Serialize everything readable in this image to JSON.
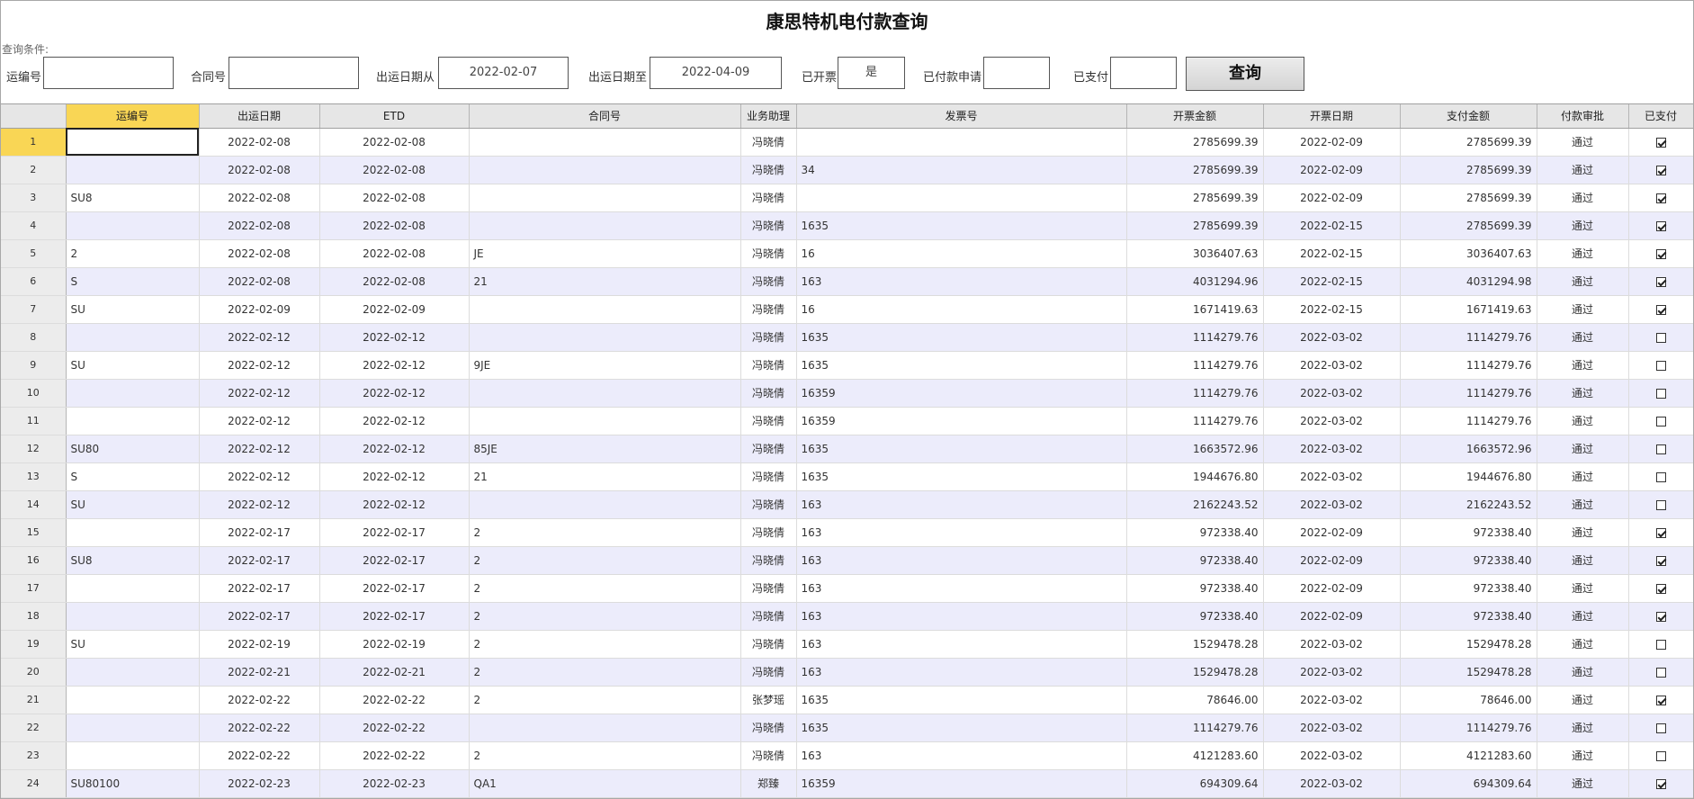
{
  "title": "康思特机电付款查询",
  "query": {
    "condition_label": "查询条件:",
    "fields": {
      "waybill": {
        "label": "运编号",
        "value": ""
      },
      "contract": {
        "label": "合同号",
        "value": ""
      },
      "date_from": {
        "label": "出运日期从",
        "value": "2022-02-07"
      },
      "date_to": {
        "label": "出运日期至",
        "value": "2022-04-09"
      },
      "invoiced": {
        "label": "已开票",
        "value": "是"
      },
      "pay_applied": {
        "label": "已付款申请",
        "value": ""
      },
      "paid": {
        "label": "已支付",
        "value": ""
      }
    },
    "button_label": "查询"
  },
  "table": {
    "columns": [
      "运编号",
      "出运日期",
      "ETD",
      "合同号",
      "业务助理",
      "发票号",
      "开票金额",
      "开票日期",
      "支付金额",
      "付款审批",
      "已支付"
    ],
    "rows": [
      {
        "no": "1",
        "waybill": "",
        "ship_date": "2022-02-08",
        "etd": "2022-02-08",
        "contract": "",
        "assistant": "冯晓倩",
        "invoice_no": "",
        "inv_amount": "2785699.39",
        "inv_date": "2022-02-09",
        "pay_amount": "2785699.39",
        "approval": "通过",
        "paid": true
      },
      {
        "no": "2",
        "waybill": "",
        "ship_date": "2022-02-08",
        "etd": "2022-02-08",
        "contract": "",
        "assistant": "冯晓倩",
        "invoice_no": "34",
        "inv_amount": "2785699.39",
        "inv_date": "2022-02-09",
        "pay_amount": "2785699.39",
        "approval": "通过",
        "paid": true
      },
      {
        "no": "3",
        "waybill": "SU8",
        "ship_date": "2022-02-08",
        "etd": "2022-02-08",
        "contract": "",
        "assistant": "冯晓倩",
        "invoice_no": "",
        "inv_amount": "2785699.39",
        "inv_date": "2022-02-09",
        "pay_amount": "2785699.39",
        "approval": "通过",
        "paid": true
      },
      {
        "no": "4",
        "waybill": "",
        "ship_date": "2022-02-08",
        "etd": "2022-02-08",
        "contract": "",
        "assistant": "冯晓倩",
        "invoice_no": "1635",
        "inv_amount": "2785699.39",
        "inv_date": "2022-02-15",
        "pay_amount": "2785699.39",
        "approval": "通过",
        "paid": true
      },
      {
        "no": "5",
        "waybill": "2",
        "ship_date": "2022-02-08",
        "etd": "2022-02-08",
        "contract": "JE",
        "assistant": "冯晓倩",
        "invoice_no": "16",
        "inv_amount": "3036407.63",
        "inv_date": "2022-02-15",
        "pay_amount": "3036407.63",
        "approval": "通过",
        "paid": true
      },
      {
        "no": "6",
        "waybill": "S",
        "ship_date": "2022-02-08",
        "etd": "2022-02-08",
        "contract": "21",
        "assistant": "冯晓倩",
        "invoice_no": "163",
        "inv_amount": "4031294.96",
        "inv_date": "2022-02-15",
        "pay_amount": "4031294.98",
        "approval": "通过",
        "paid": true
      },
      {
        "no": "7",
        "waybill": "SU",
        "ship_date": "2022-02-09",
        "etd": "2022-02-09",
        "contract": "",
        "assistant": "冯晓倩",
        "invoice_no": "16",
        "inv_amount": "1671419.63",
        "inv_date": "2022-02-15",
        "pay_amount": "1671419.63",
        "approval": "通过",
        "paid": true
      },
      {
        "no": "8",
        "waybill": "",
        "ship_date": "2022-02-12",
        "etd": "2022-02-12",
        "contract": "",
        "assistant": "冯晓倩",
        "invoice_no": "1635",
        "inv_amount": "1114279.76",
        "inv_date": "2022-03-02",
        "pay_amount": "1114279.76",
        "approval": "通过",
        "paid": false
      },
      {
        "no": "9",
        "waybill": "SU",
        "ship_date": "2022-02-12",
        "etd": "2022-02-12",
        "contract": "9JE",
        "assistant": "冯晓倩",
        "invoice_no": "1635",
        "inv_amount": "1114279.76",
        "inv_date": "2022-03-02",
        "pay_amount": "1114279.76",
        "approval": "通过",
        "paid": false
      },
      {
        "no": "10",
        "waybill": "",
        "ship_date": "2022-02-12",
        "etd": "2022-02-12",
        "contract": "",
        "assistant": "冯晓倩",
        "invoice_no": "16359",
        "inv_amount": "1114279.76",
        "inv_date": "2022-03-02",
        "pay_amount": "1114279.76",
        "approval": "通过",
        "paid": false
      },
      {
        "no": "11",
        "waybill": "",
        "ship_date": "2022-02-12",
        "etd": "2022-02-12",
        "contract": "",
        "assistant": "冯晓倩",
        "invoice_no": "16359",
        "inv_amount": "1114279.76",
        "inv_date": "2022-03-02",
        "pay_amount": "1114279.76",
        "approval": "通过",
        "paid": false
      },
      {
        "no": "12",
        "waybill": "SU80",
        "ship_date": "2022-02-12",
        "etd": "2022-02-12",
        "contract": "85JE",
        "assistant": "冯晓倩",
        "invoice_no": "1635",
        "inv_amount": "1663572.96",
        "inv_date": "2022-03-02",
        "pay_amount": "1663572.96",
        "approval": "通过",
        "paid": false
      },
      {
        "no": "13",
        "waybill": "S",
        "ship_date": "2022-02-12",
        "etd": "2022-02-12",
        "contract": "21",
        "assistant": "冯晓倩",
        "invoice_no": "1635",
        "inv_amount": "1944676.80",
        "inv_date": "2022-03-02",
        "pay_amount": "1944676.80",
        "approval": "通过",
        "paid": false
      },
      {
        "no": "14",
        "waybill": "SU",
        "ship_date": "2022-02-12",
        "etd": "2022-02-12",
        "contract": "",
        "assistant": "冯晓倩",
        "invoice_no": "163",
        "inv_amount": "2162243.52",
        "inv_date": "2022-03-02",
        "pay_amount": "2162243.52",
        "approval": "通过",
        "paid": false
      },
      {
        "no": "15",
        "waybill": "",
        "ship_date": "2022-02-17",
        "etd": "2022-02-17",
        "contract": "2",
        "assistant": "冯晓倩",
        "invoice_no": "163",
        "inv_amount": "972338.40",
        "inv_date": "2022-02-09",
        "pay_amount": "972338.40",
        "approval": "通过",
        "paid": true
      },
      {
        "no": "16",
        "waybill": "SU8",
        "ship_date": "2022-02-17",
        "etd": "2022-02-17",
        "contract": "2",
        "assistant": "冯晓倩",
        "invoice_no": "163",
        "inv_amount": "972338.40",
        "inv_date": "2022-02-09",
        "pay_amount": "972338.40",
        "approval": "通过",
        "paid": true
      },
      {
        "no": "17",
        "waybill": "",
        "ship_date": "2022-02-17",
        "etd": "2022-02-17",
        "contract": "2",
        "assistant": "冯晓倩",
        "invoice_no": "163",
        "inv_amount": "972338.40",
        "inv_date": "2022-02-09",
        "pay_amount": "972338.40",
        "approval": "通过",
        "paid": true
      },
      {
        "no": "18",
        "waybill": "",
        "ship_date": "2022-02-17",
        "etd": "2022-02-17",
        "contract": "2",
        "assistant": "冯晓倩",
        "invoice_no": "163",
        "inv_amount": "972338.40",
        "inv_date": "2022-02-09",
        "pay_amount": "972338.40",
        "approval": "通过",
        "paid": true
      },
      {
        "no": "19",
        "waybill": "SU",
        "ship_date": "2022-02-19",
        "etd": "2022-02-19",
        "contract": "2",
        "assistant": "冯晓倩",
        "invoice_no": "163",
        "inv_amount": "1529478.28",
        "inv_date": "2022-03-02",
        "pay_amount": "1529478.28",
        "approval": "通过",
        "paid": false
      },
      {
        "no": "20",
        "waybill": "",
        "ship_date": "2022-02-21",
        "etd": "2022-02-21",
        "contract": "2",
        "assistant": "冯晓倩",
        "invoice_no": "163",
        "inv_amount": "1529478.28",
        "inv_date": "2022-03-02",
        "pay_amount": "1529478.28",
        "approval": "通过",
        "paid": false
      },
      {
        "no": "21",
        "waybill": "",
        "ship_date": "2022-02-22",
        "etd": "2022-02-22",
        "contract": "2",
        "assistant": "张梦瑶",
        "invoice_no": "1635",
        "inv_amount": "78646.00",
        "inv_date": "2022-03-02",
        "pay_amount": "78646.00",
        "approval": "通过",
        "paid": true
      },
      {
        "no": "22",
        "waybill": "",
        "ship_date": "2022-02-22",
        "etd": "2022-02-22",
        "contract": "",
        "assistant": "冯晓倩",
        "invoice_no": "1635",
        "inv_amount": "1114279.76",
        "inv_date": "2022-03-02",
        "pay_amount": "1114279.76",
        "approval": "通过",
        "paid": false
      },
      {
        "no": "23",
        "waybill": "",
        "ship_date": "2022-02-22",
        "etd": "2022-02-22",
        "contract": "2",
        "assistant": "冯晓倩",
        "invoice_no": "163",
        "inv_amount": "4121283.60",
        "inv_date": "2022-03-02",
        "pay_amount": "4121283.60",
        "approval": "通过",
        "paid": false
      },
      {
        "no": "24",
        "waybill": "SU80100",
        "ship_date": "2022-02-23",
        "etd": "2022-02-23",
        "contract": "QA1",
        "assistant": "郑臻",
        "invoice_no": "16359",
        "inv_amount": "694309.64",
        "inv_date": "2022-03-02",
        "pay_amount": "694309.64",
        "approval": "通过",
        "paid": true
      }
    ]
  }
}
